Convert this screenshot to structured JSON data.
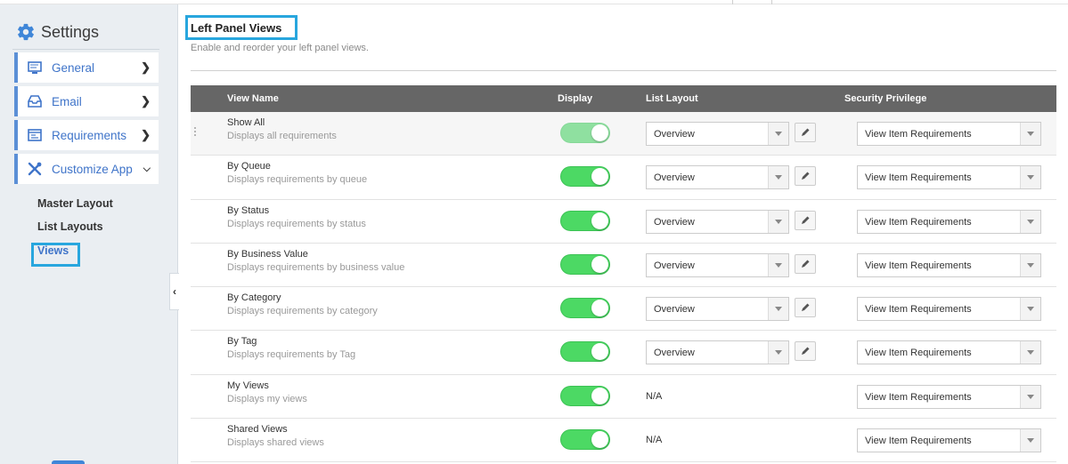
{
  "sidebar": {
    "title": "Settings",
    "menu": [
      {
        "label": "General",
        "icon": "monitor-icon",
        "chevron": "right"
      },
      {
        "label": "Email",
        "icon": "inbox-icon",
        "chevron": "right"
      },
      {
        "label": "Requirements",
        "icon": "requirements-icon",
        "chevron": "right"
      },
      {
        "label": "Customize App",
        "icon": "wrench-screwdriver-icon",
        "chevron": "down"
      }
    ],
    "submenu": [
      {
        "label": "Master Layout"
      },
      {
        "label": "List Layouts"
      },
      {
        "label": "Views",
        "active": true
      }
    ]
  },
  "main": {
    "title": "Left Panel Views",
    "subtitle": "Enable and reorder your left panel views.",
    "columns": {
      "view_name": "View Name",
      "display": "Display",
      "list_layout": "List Layout",
      "security_privilege": "Security Privilege"
    },
    "rows": [
      {
        "name": "Show All",
        "desc": "Displays all requirements",
        "display_on": true,
        "layout": "Overview",
        "privilege": "View Item Requirements"
      },
      {
        "name": "By Queue",
        "desc": "Displays requirements by queue",
        "display_on": true,
        "layout": "Overview",
        "privilege": "View Item Requirements"
      },
      {
        "name": "By Status",
        "desc": "Displays requirements by status",
        "display_on": true,
        "layout": "Overview",
        "privilege": "View Item Requirements"
      },
      {
        "name": "By Business Value",
        "desc": "Displays requirements by business value",
        "display_on": true,
        "layout": "Overview",
        "privilege": "View Item Requirements"
      },
      {
        "name": "By Category",
        "desc": "Displays requirements by category",
        "display_on": true,
        "layout": "Overview",
        "privilege": "View Item Requirements"
      },
      {
        "name": "By Tag",
        "desc": "Displays requirements by Tag",
        "display_on": true,
        "layout": "Overview",
        "privilege": "View Item Requirements"
      },
      {
        "name": "My Views",
        "desc": "Displays my views",
        "display_on": true,
        "layout": "N/A",
        "privilege": "View Item Requirements"
      },
      {
        "name": "Shared Views",
        "desc": "Displays shared views",
        "display_on": true,
        "layout": "N/A",
        "privilege": "View Item Requirements"
      }
    ]
  },
  "colors": {
    "accent": "#3f74c9",
    "highlight_box": "#28a6de",
    "toggle_on": "#4cd964",
    "header_bg": "#666666"
  }
}
